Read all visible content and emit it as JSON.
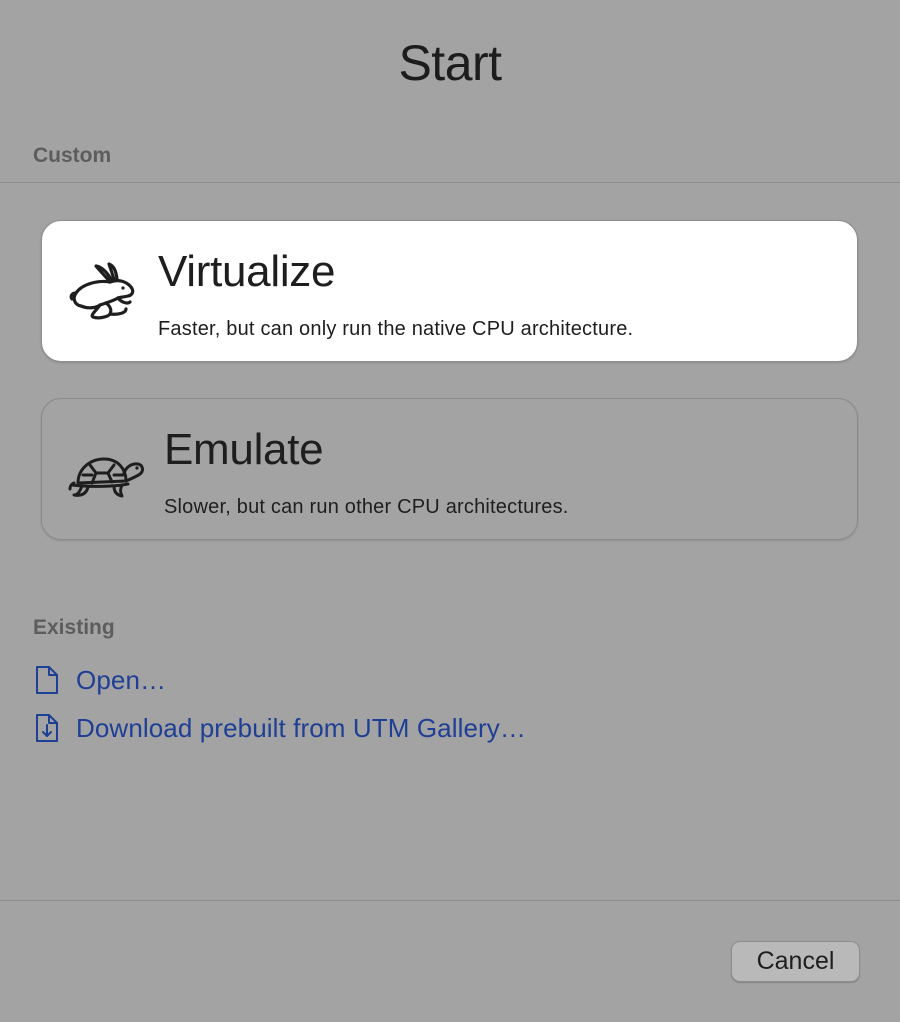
{
  "window": {
    "title": "Start"
  },
  "sections": {
    "custom_label": "Custom",
    "existing_label": "Existing"
  },
  "options": [
    {
      "title": "Virtualize",
      "description": "Faster, but can only run the native CPU architecture.",
      "icon": "hare-icon",
      "selected": true
    },
    {
      "title": "Emulate",
      "description": "Slower, but can run other CPU architectures.",
      "icon": "tortoise-icon",
      "selected": false
    }
  ],
  "existing": {
    "open_label": "Open…",
    "open_icon": "document-icon",
    "gallery_label": "Download prebuilt from UTM Gallery…",
    "gallery_icon": "document-download-icon"
  },
  "footer": {
    "cancel_label": "Cancel"
  },
  "colors": {
    "background": "#a3a3a3",
    "selected_card": "#ffffff",
    "link": "#1f3f95",
    "section_label": "#5d5d5d"
  }
}
